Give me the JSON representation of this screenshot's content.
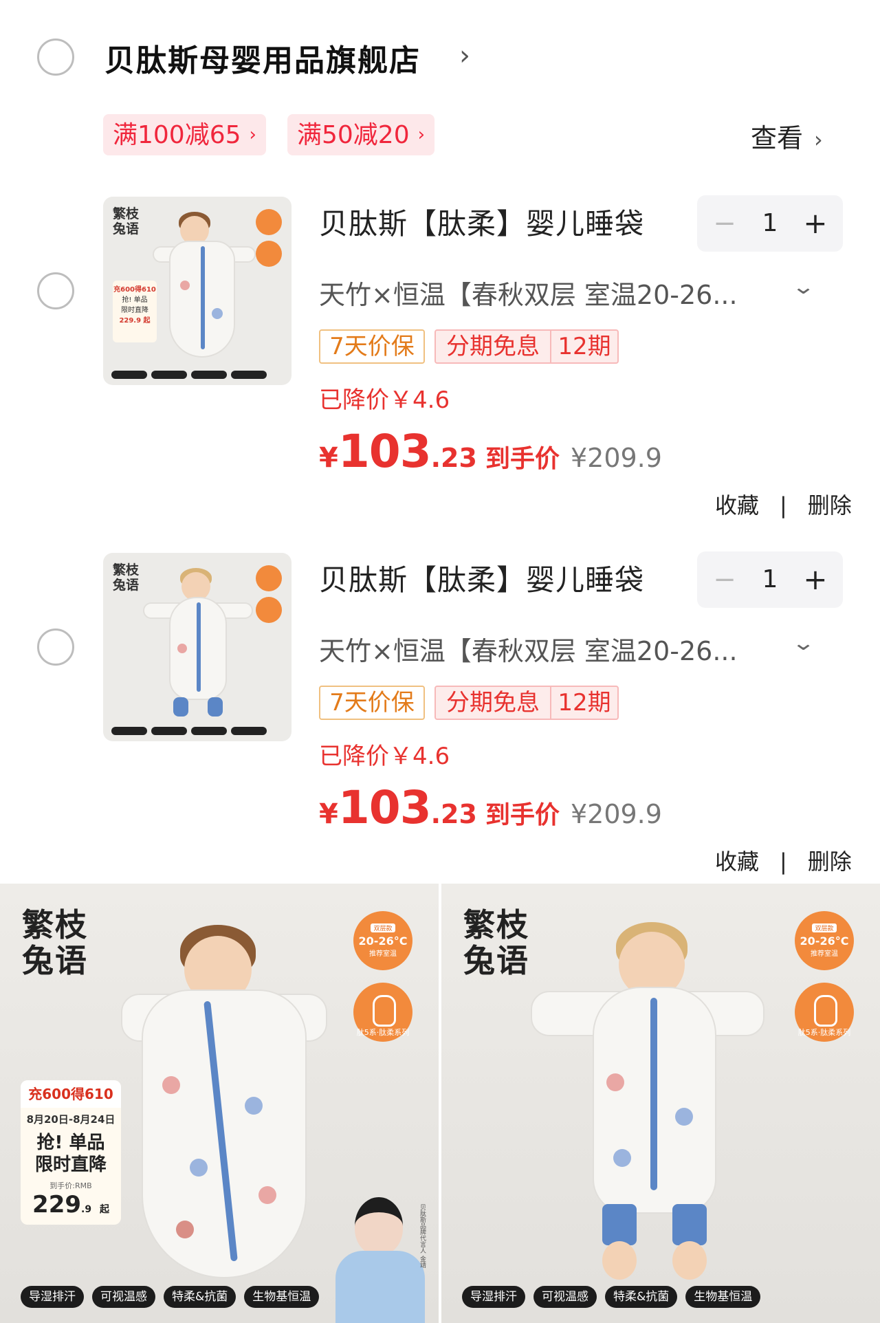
{
  "store": {
    "name": "贝肽斯母婴用品旗舰店",
    "chevron": "›",
    "coupons": [
      {
        "label": "满100减65"
      },
      {
        "label": "满50减20"
      }
    ],
    "view_label": "查看"
  },
  "items": [
    {
      "title": "贝肽斯【肽柔】婴儿睡袋",
      "quantity": "1",
      "minus": "−",
      "plus": "+",
      "variant": "天竹×恒温【春秋双层 室温20-26...",
      "tag_guarantee": "7天价保",
      "tag_installment": "分期免息",
      "tag_installment_periods": "12期",
      "price_drop": "已降价￥4.6",
      "price_currency": "¥",
      "price_integer": "103",
      "price_decimal": ".23",
      "price_label": "到手价",
      "original_price": "¥209.9",
      "favorite_label": "收藏",
      "separator": "|",
      "delete_label": "删除",
      "thumb_brand": "繁枝\n兔语",
      "thumb_promo": [
        "充600得610",
        "抢! 单品",
        "限时直降",
        "229.9 起"
      ]
    },
    {
      "title": "贝肽斯【肽柔】婴儿睡袋",
      "quantity": "1",
      "minus": "−",
      "plus": "+",
      "variant": "天竹×恒温【春秋双层 室温20-26...",
      "tag_guarantee": "7天价保",
      "tag_installment": "分期免息",
      "tag_installment_periods": "12期",
      "price_drop": "已降价￥4.6",
      "price_currency": "¥",
      "price_integer": "103",
      "price_decimal": ".23",
      "price_label": "到手价",
      "original_price": "¥209.9",
      "favorite_label": "收藏",
      "separator": "|",
      "delete_label": "删除",
      "thumb_brand": "繁枝\n兔语"
    }
  ],
  "gallery": [
    {
      "brand_line1": "繁枝",
      "brand_line2": "兔语",
      "temp_tag": "双层款",
      "temp_range": "20-26°C",
      "temp_note": "推荐室温",
      "series_note": "肽5系·肽柔系列",
      "promo": {
        "header": "充600得610",
        "dates": "8月20日-8月24日",
        "line1": "抢! 单品",
        "line2": "限时直降",
        "sub": "到手价:RMB",
        "price_int": "229",
        "price_dec": ".9",
        "price_suffix": "起"
      },
      "features": [
        "导湿排汗",
        "可视温感",
        "特柔&抗菌",
        "生物基恒温"
      ],
      "ambassador": "贝肽斯品牌代言人 金靖"
    },
    {
      "brand_line1": "繁枝",
      "brand_line2": "兔语",
      "temp_tag": "双层款",
      "temp_range": "20-26°C",
      "temp_note": "推荐室温",
      "series_note": "肽5系·肽柔系列",
      "features": [
        "导湿排汗",
        "可视温感",
        "特柔&抗菌",
        "生物基恒温"
      ]
    }
  ],
  "colors": {
    "accent_red": "#e8322f",
    "coupon_bg": "#fde8ea",
    "guarantee_orange": "#e37b1a",
    "badge_orange": "#f28a3c",
    "zip_blue": "#5b86c6"
  }
}
